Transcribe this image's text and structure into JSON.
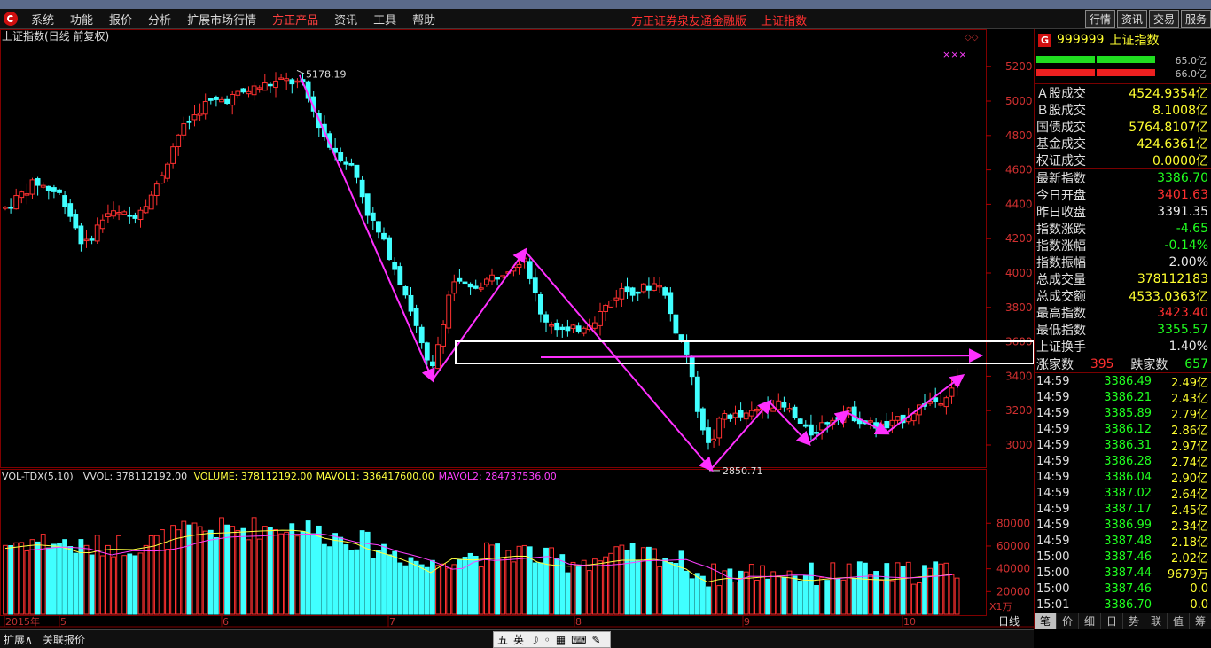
{
  "menu": {
    "items": [
      "系统",
      "功能",
      "报价",
      "分析",
      "扩展市场行情",
      "方正产品",
      "资讯",
      "工具",
      "帮助"
    ],
    "active_index": 5,
    "brand": "方正证券泉友通金融版",
    "index_name": "上证指数",
    "right_buttons": [
      "行情",
      "资讯",
      "交易",
      "服务"
    ]
  },
  "chart": {
    "title": "上证指数(日线 前复权)",
    "high_label": "5178.19",
    "low_label": "2850.71",
    "price_ticks": [
      "5200",
      "5000",
      "4800",
      "4600",
      "4400",
      "4200",
      "4000",
      "3800",
      "3600",
      "3400",
      "3200",
      "3000"
    ],
    "volume_header": {
      "name": "VOL-TDX(5,10)",
      "vvol": "VVOL: 378112192.00",
      "volume": "VOLUME: 378112192.00",
      "mavol1": "MAVOL1: 336417600.00",
      "mavol2": "MAVOL2: 284737536.00"
    },
    "volume_ticks": [
      "80000",
      "60000",
      "40000",
      "20000"
    ],
    "volume_unit": "X1万",
    "period_label": "日线",
    "date_labels": [
      "2015年",
      "5",
      "6",
      "7",
      "8",
      "9",
      "10"
    ],
    "marker": "×××",
    "colors": {
      "up": "#ff3030",
      "down": "#40ffff",
      "arrow": "#ff30ff",
      "box": "#ffffff",
      "ma1": "#ffff40",
      "ma2": "#ff40ff"
    }
  },
  "chart_data": {
    "type": "candlestick",
    "title": "上证指数(日线 前复权)",
    "ylim": [
      2800,
      5300
    ],
    "annotations": [
      "5178.19",
      "2850.71"
    ],
    "volume_ylim": [
      0,
      95000
    ]
  },
  "quote": {
    "code": "999999",
    "name": "上证指数",
    "bar_labels": [
      "65.0亿",
      "66.0亿"
    ],
    "turnover": [
      {
        "label": "Ａ股成交",
        "value": "4524.9354亿"
      },
      {
        "label": "Ｂ股成交",
        "value": "8.1008亿"
      },
      {
        "label": "国债成交",
        "value": "5764.8107亿"
      },
      {
        "label": "基金成交",
        "value": "424.6361亿"
      },
      {
        "label": "权证成交",
        "value": "0.0000亿"
      }
    ],
    "stats": [
      {
        "label": "最新指数",
        "value": "3386.70",
        "color": "green"
      },
      {
        "label": "今日开盘",
        "value": "3401.63",
        "color": "red"
      },
      {
        "label": "昨日收盘",
        "value": "3391.35",
        "color": "white"
      },
      {
        "label": "指数涨跌",
        "value": "-4.65",
        "color": "green"
      },
      {
        "label": "指数涨幅",
        "value": "-0.14%",
        "color": "green"
      },
      {
        "label": "指数振幅",
        "value": "2.00%",
        "color": "white"
      },
      {
        "label": "总成交量",
        "value": "378112183",
        "color": "yellow"
      },
      {
        "label": "总成交额",
        "value": "4533.0363亿",
        "color": "yellow"
      },
      {
        "label": "最高指数",
        "value": "3423.40",
        "color": "red"
      },
      {
        "label": "最低指数",
        "value": "3355.57",
        "color": "green"
      },
      {
        "label": "上证换手",
        "value": "1.40%",
        "color": "white"
      }
    ],
    "rise_label": "涨家数",
    "rise_count": "395",
    "fall_label": "跌家数",
    "fall_count": "657",
    "ticks": [
      {
        "time": "14:59",
        "price": "3386.49",
        "vol": "2.49亿"
      },
      {
        "time": "14:59",
        "price": "3386.21",
        "vol": "2.43亿"
      },
      {
        "time": "14:59",
        "price": "3385.89",
        "vol": "2.79亿"
      },
      {
        "time": "14:59",
        "price": "3386.12",
        "vol": "2.86亿"
      },
      {
        "time": "14:59",
        "price": "3386.31",
        "vol": "2.97亿"
      },
      {
        "time": "14:59",
        "price": "3386.28",
        "vol": "2.74亿"
      },
      {
        "time": "14:59",
        "price": "3386.04",
        "vol": "2.90亿"
      },
      {
        "time": "14:59",
        "price": "3387.02",
        "vol": "2.64亿"
      },
      {
        "time": "14:59",
        "price": "3387.17",
        "vol": "2.45亿"
      },
      {
        "time": "14:59",
        "price": "3386.99",
        "vol": "2.34亿"
      },
      {
        "time": "14:59",
        "price": "3387.48",
        "vol": "2.18亿"
      },
      {
        "time": "15:00",
        "price": "3387.46",
        "vol": "2.02亿"
      },
      {
        "time": "15:00",
        "price": "3387.44",
        "vol": "9679万"
      },
      {
        "time": "15:00",
        "price": "3387.46",
        "vol": "0.0"
      },
      {
        "time": "15:01",
        "price": "3386.70",
        "vol": "0.0"
      }
    ],
    "tabs": [
      "笔",
      "价",
      "细",
      "日",
      "势",
      "联",
      "值",
      "筹"
    ]
  },
  "status": {
    "expand": "扩展∧",
    "related": "关联报价",
    "ime": [
      "五",
      "英",
      "☽",
      "◦",
      "▦",
      "⌨",
      "✎"
    ]
  }
}
